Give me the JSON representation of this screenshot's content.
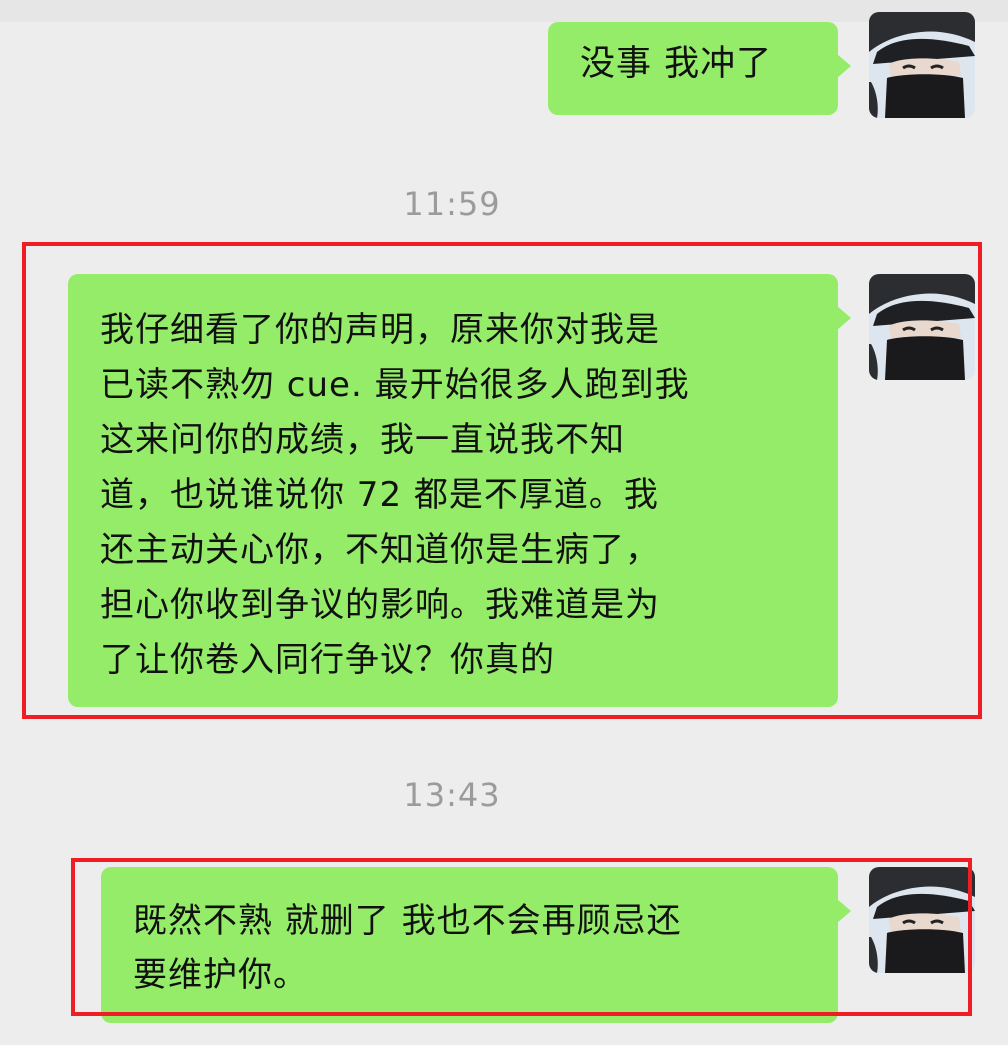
{
  "messages": [
    {
      "lines": [
        "没事 我冲了"
      ]
    },
    {
      "lines": [
        "我仔细看了你的声明，原来你对我是",
        "已读不熟勿 cue. 最开始很多人跑到我",
        "这来问你的成绩，我一直说我不知",
        "道，也说谁说你 72 都是不厚道。我",
        "还主动关心你，不知道你是生病了，",
        "担心你收到争议的影响。我难道是为",
        "了让你卷入同行争议？你真的"
      ]
    },
    {
      "lines": [
        "既然不熟 就删了 我也不会再顾忌还",
        "要维护你。"
      ]
    }
  ],
  "timestamps": [
    "11:59",
    "13:43"
  ],
  "colors": {
    "background": "#ededed",
    "bubble_outgoing": "#95ec69",
    "timestamp_text": "#9b9b9b",
    "highlight_border": "#ee1e24"
  },
  "icons": {
    "avatar": "user-avatar-helmet-mask"
  }
}
